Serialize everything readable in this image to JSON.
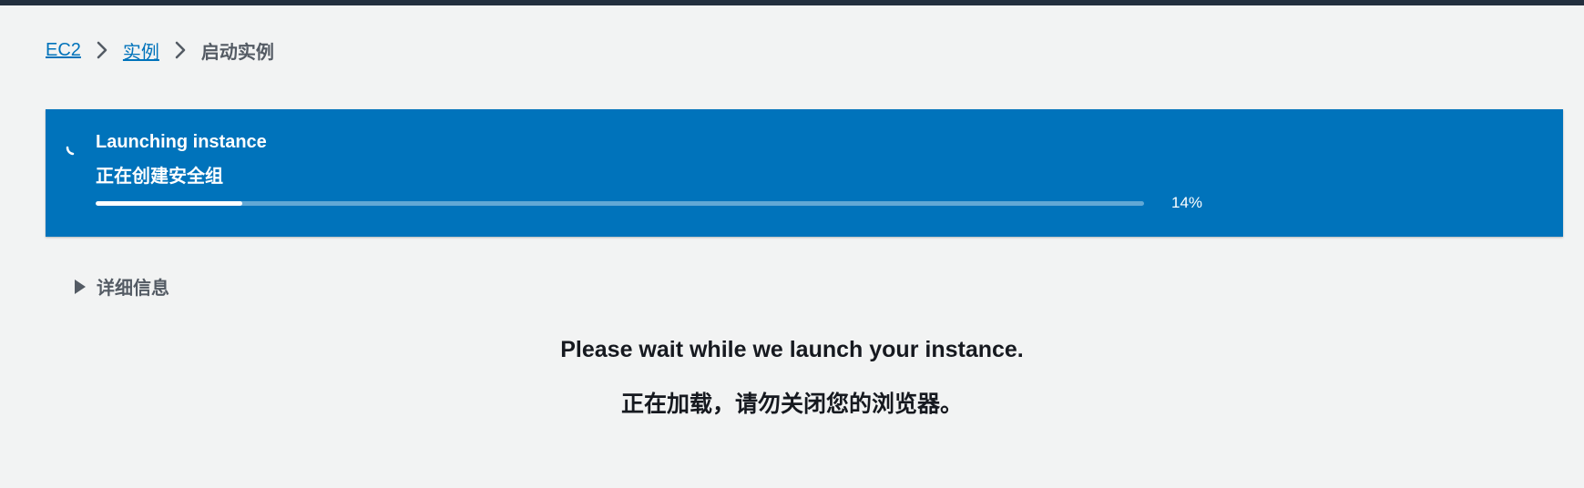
{
  "breadcrumb": {
    "items": [
      {
        "label": "EC2",
        "link": true
      },
      {
        "label": "实例",
        "link": true
      },
      {
        "label": "启动实例",
        "link": false
      }
    ]
  },
  "flash": {
    "title": "Launching instance",
    "subtitle": "正在创建安全组",
    "progress_percent": 14,
    "progress_label": "14%",
    "background_color": "#0073bb",
    "icon": "spinner-icon"
  },
  "details": {
    "label": "详细信息",
    "icon": "caret-right-icon"
  },
  "message": {
    "primary": "Please wait while we launch your instance.",
    "secondary": "正在加载，请勿关闭您的浏览器。"
  }
}
